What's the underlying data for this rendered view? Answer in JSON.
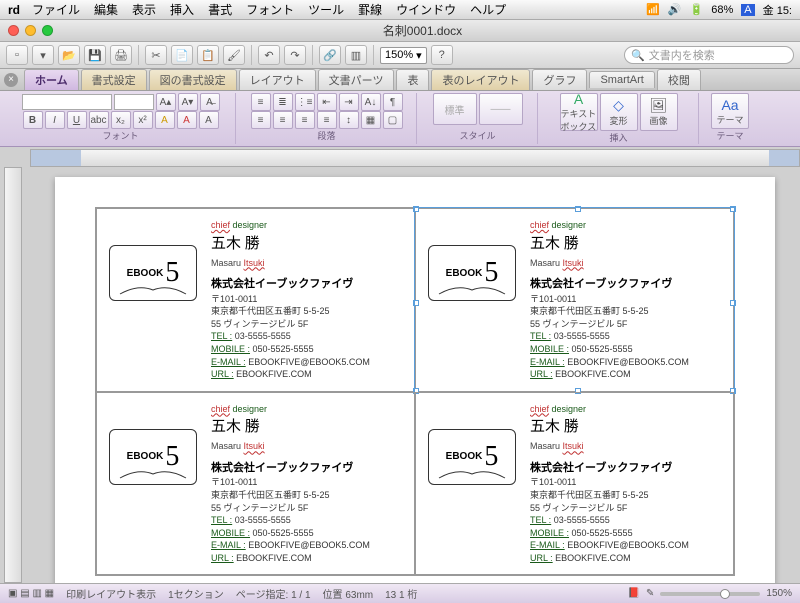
{
  "menubar": {
    "app": "rd",
    "items": [
      "ファイル",
      "編集",
      "表示",
      "挿入",
      "書式",
      "フォント",
      "ツール",
      "罫線",
      "ウインドウ",
      "ヘルプ"
    ],
    "battery": "68%",
    "clock": "金 15:"
  },
  "titlebar": {
    "title": "名刺0001.docx"
  },
  "toolbar": {
    "zoom": "150%",
    "search_placeholder": "文書内を検索"
  },
  "tabs": [
    "ホーム",
    "書式設定",
    "図の書式設定",
    "レイアウト",
    "文書パーツ",
    "表",
    "表のレイアウト",
    "グラフ",
    "SmartArt",
    "校閲"
  ],
  "ribbon": {
    "groups": [
      "フォント",
      "段落",
      "スタイル",
      "挿入",
      "テーマ"
    ],
    "insert_btns": [
      "テキストボックス",
      "変形",
      "画像",
      "テーマ"
    ],
    "std_label": "標準"
  },
  "card": {
    "role_chief": "chief",
    "role_designer": " designer",
    "name": "五木 勝",
    "roman1": "Masaru ",
    "roman2": "Itsuki",
    "company": "株式会社イーブックファイヴ",
    "postal": "〒101-0011",
    "address1": "東京都千代田区五番町 5-5-25",
    "address2": "55 ヴィンテージビル 5F",
    "tel_lbl": "TEL :",
    "tel": " 03-5555-5555",
    "mobile_lbl": "MOBILE :",
    "mobile": " 050-5525-5555",
    "email_lbl": "E-MAIL :",
    "email": " EBOOKFIVE@EBOOK5.COM",
    "url_lbl": "URL :",
    "url": " EBOOKFIVE.COM",
    "logo_text": "EBOOK",
    "logo_num": "5"
  },
  "status": {
    "view": "印刷レイアウト表示",
    "section": "1セクション",
    "page_lbl": "ページ指定:",
    "page": "1 / 1",
    "pos_lbl": "位置",
    "pos": "63mm",
    "col": "13",
    "col_lbl": "1 桁",
    "zoom": "150%"
  }
}
